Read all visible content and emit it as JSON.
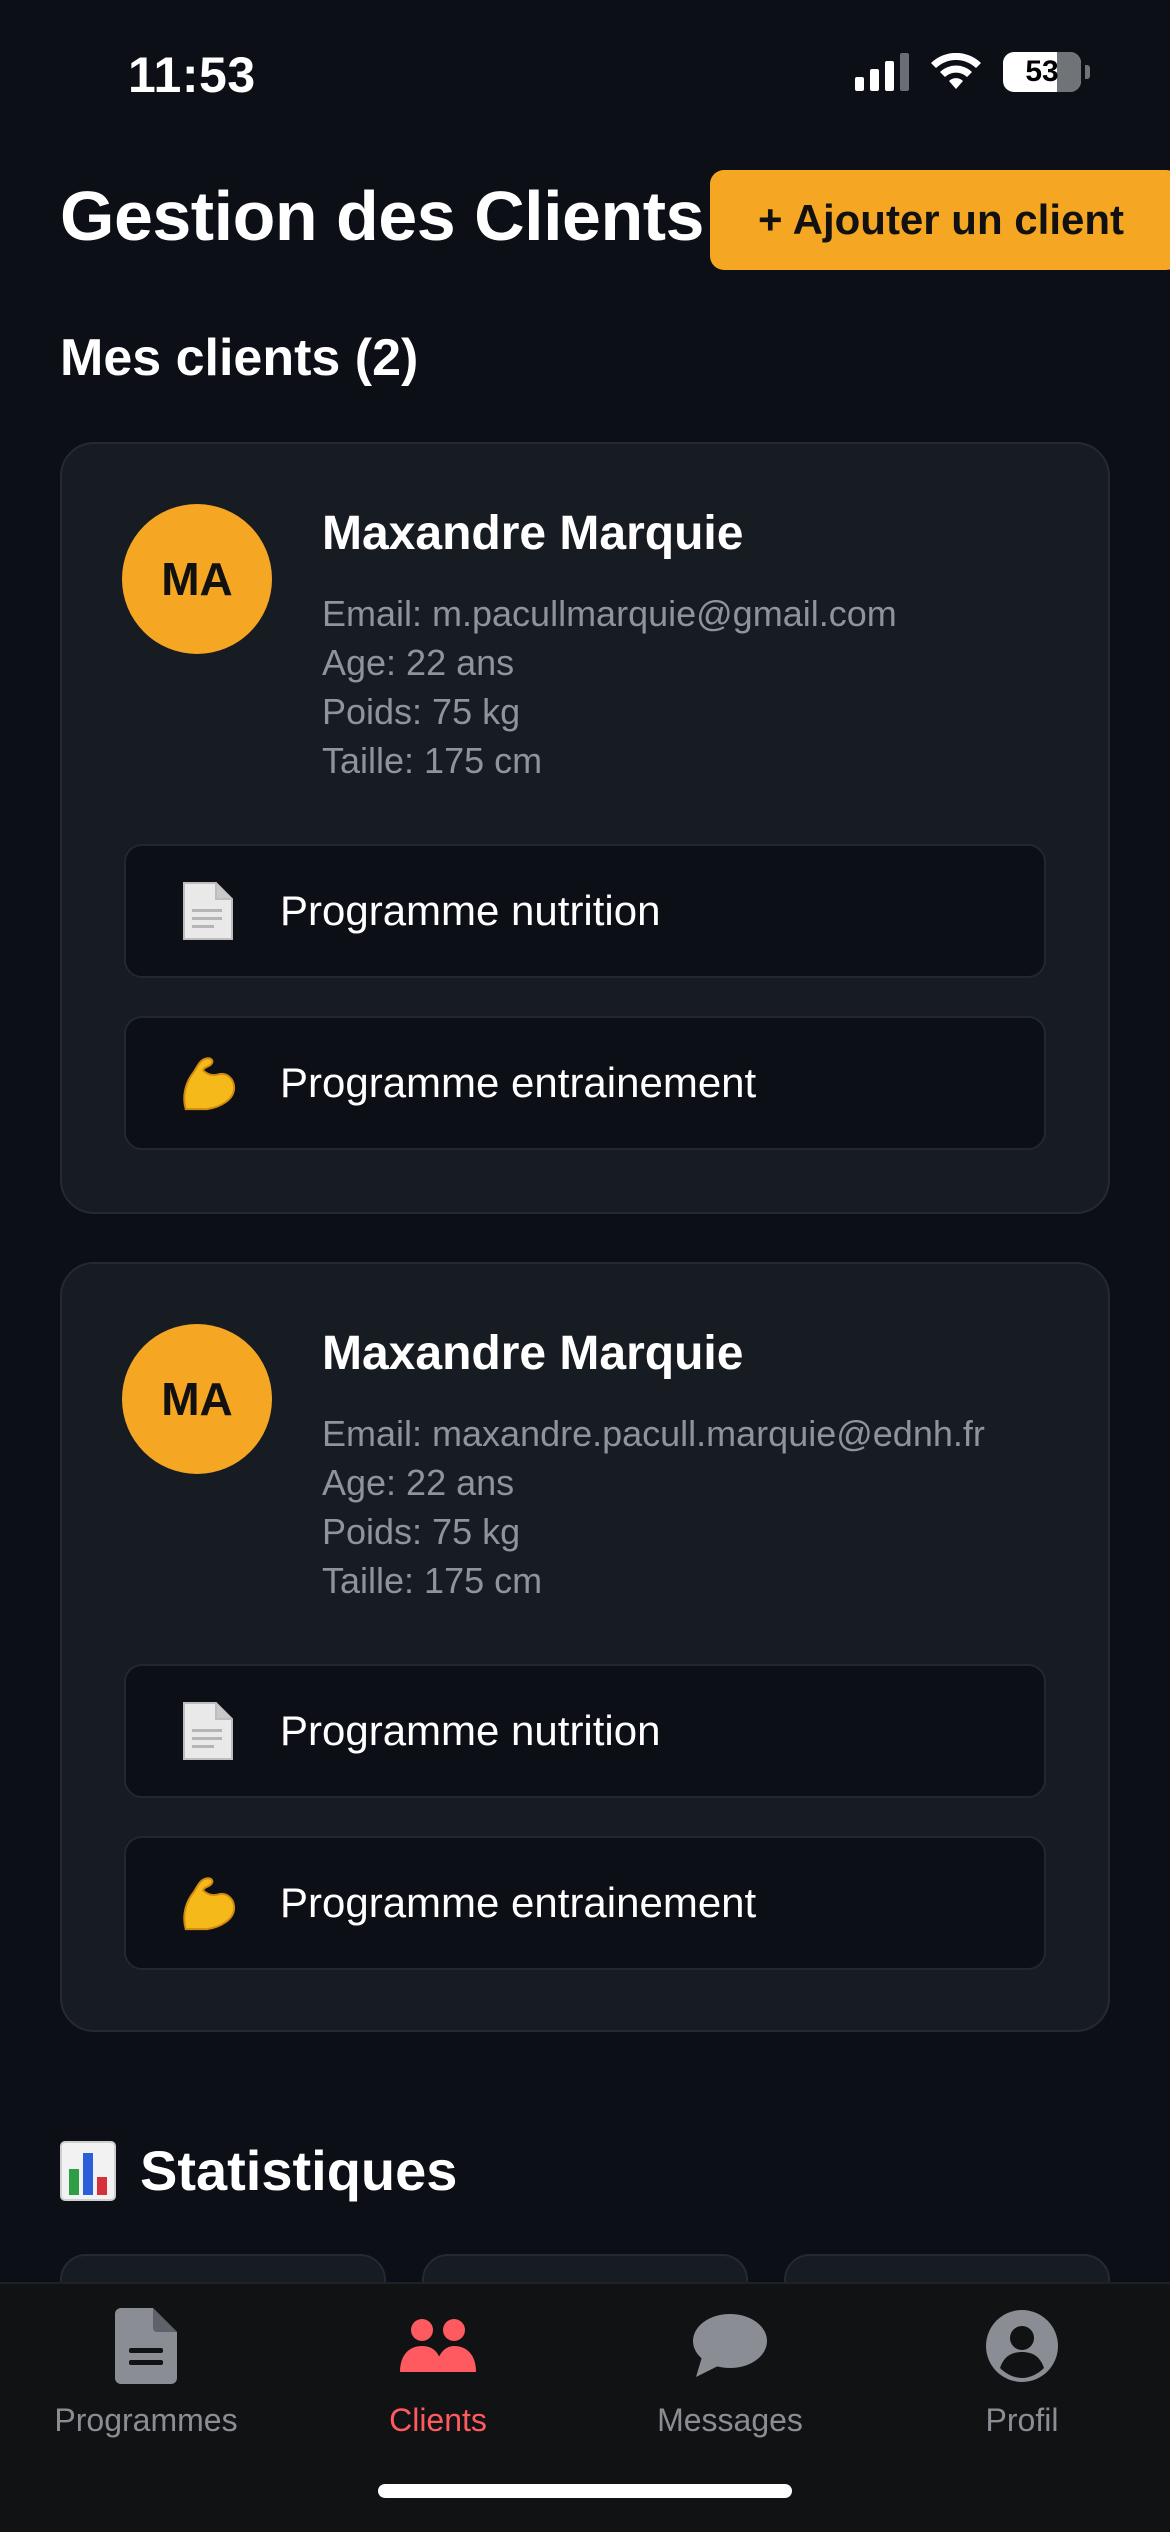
{
  "status_bar": {
    "time": "11:53",
    "battery": "53"
  },
  "header": {
    "title": "Gestion des Clients",
    "add_button_label": "+ Ajouter un client"
  },
  "clients_section": {
    "title": "Mes clients (2)"
  },
  "clients": [
    {
      "initials": "MA",
      "name": "Maxandre Marquie",
      "email": "Email: m.pacullmarquie@gmail.com",
      "age": "Age: 22 ans",
      "weight": "Poids: 75 kg",
      "height": "Taille: 175 cm",
      "buttons": [
        {
          "icon": "document-icon",
          "label": "Programme nutrition"
        },
        {
          "icon": "flexed-biceps-icon",
          "label": "Programme entrainement"
        }
      ]
    },
    {
      "initials": "MA",
      "name": "Maxandre Marquie",
      "email": "Email: maxandre.pacull.marquie@ednh.fr",
      "age": "Age: 22 ans",
      "weight": "Poids: 75 kg",
      "height": "Taille: 175 cm",
      "buttons": [
        {
          "icon": "document-icon",
          "label": "Programme nutrition"
        },
        {
          "icon": "flexed-biceps-icon",
          "label": "Programme entrainement"
        }
      ]
    }
  ],
  "stats_section": {
    "icon": "bar-chart-icon",
    "title": "Statistiques"
  },
  "tab_bar": {
    "tabs": [
      {
        "icon": "document-icon",
        "label": "Programmes",
        "active": false
      },
      {
        "icon": "users-icon",
        "label": "Clients",
        "active": true
      },
      {
        "icon": "chat-bubble-icon",
        "label": "Messages",
        "active": false
      },
      {
        "icon": "user-circle-icon",
        "label": "Profil",
        "active": false
      }
    ]
  },
  "colors": {
    "accent": "#f5a623",
    "active_tab": "#ff5a5f",
    "background": "#0c0f16",
    "card": "#171b22"
  }
}
